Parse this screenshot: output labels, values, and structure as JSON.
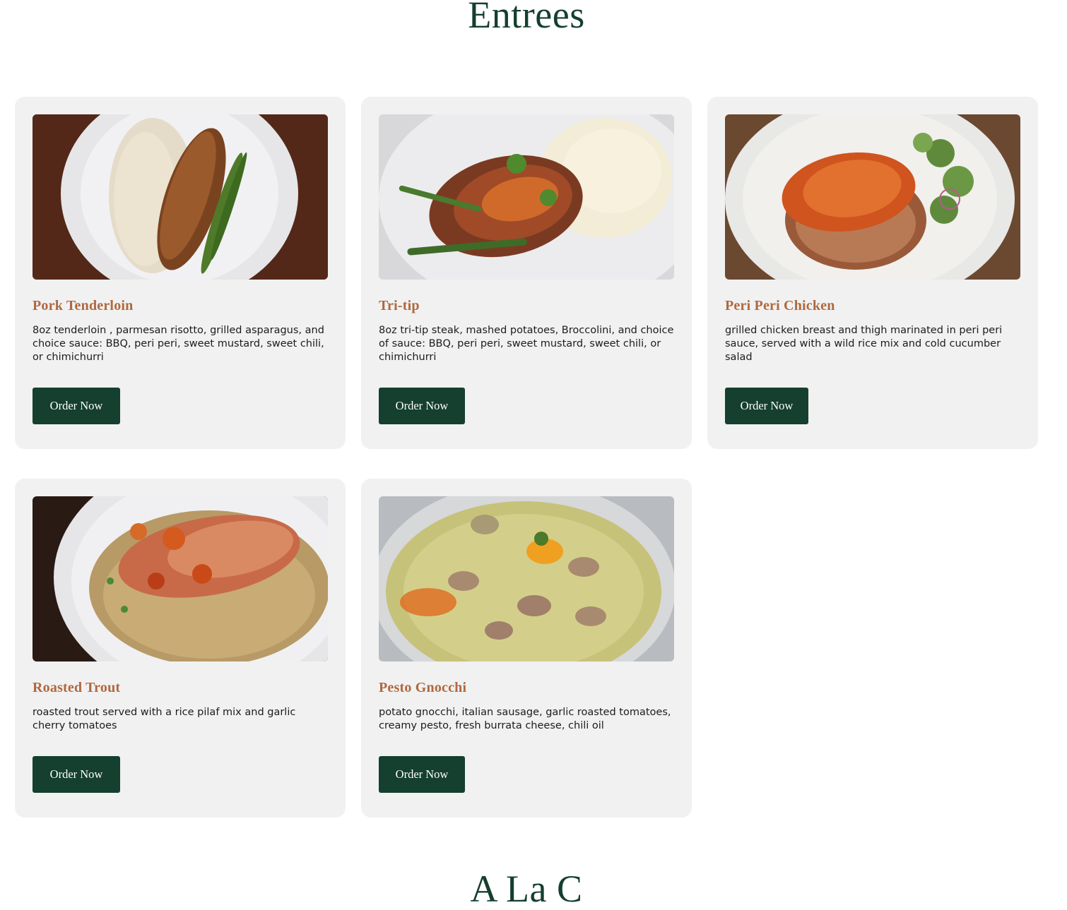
{
  "section": {
    "title": "Entrees",
    "next_title": "A La C"
  },
  "colors": {
    "title_green": "#153f2e",
    "item_name": "#b0683f",
    "card_bg": "#f1f1f1",
    "button_bg": "#153f2e"
  },
  "items": [
    {
      "name": "Pork Tenderloin",
      "description": "8oz tenderloin , parmesan risotto, grilled asparagus, and choice sauce: BBQ, peri peri, sweet mustard, sweet chili, or chimichurri",
      "button": "Order Now",
      "photo_icon": "pork-tenderloin-photo"
    },
    {
      "name": "Tri-tip",
      "description": "8oz tri-tip steak, mashed potatoes, Broccolini, and choice of sauce: BBQ, peri peri, sweet mustard, sweet chili, or chimichurri",
      "button": "Order Now",
      "photo_icon": "tri-tip-photo"
    },
    {
      "name": "Peri Peri Chicken",
      "description": "grilled chicken breast and thigh marinated in peri peri sauce, served with a wild rice mix and cold cucumber salad",
      "button": "Order Now",
      "photo_icon": "peri-peri-chicken-photo"
    },
    {
      "name": "Roasted Trout",
      "description": "roasted trout served with a rice pilaf mix and garlic cherry tomatoes",
      "button": "Order Now",
      "photo_icon": "roasted-trout-photo"
    },
    {
      "name": "Pesto Gnocchi",
      "description": "potato gnocchi, italian sausage, garlic roasted tomatoes, creamy pesto, fresh burrata cheese, chili oil",
      "button": "Order Now",
      "photo_icon": "pesto-gnocchi-photo"
    }
  ]
}
